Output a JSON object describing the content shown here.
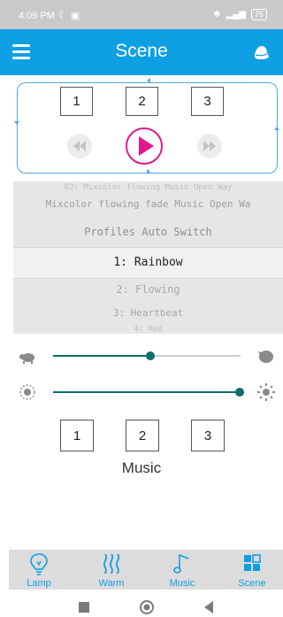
{
  "status": {
    "time": "4:09 PM",
    "battery": "75"
  },
  "appbar": {
    "title": "Scene"
  },
  "top_buttons": [
    "1",
    "2",
    "3"
  ],
  "picker": {
    "rows": [
      "02: Mixcolor flowing Music Open Way",
      "Mixcolor flowing fade Music Open Wa",
      "Profiles Auto Switch",
      "1: Rainbow",
      "2: Flowing",
      "3: Heartbeat",
      "4: Red"
    ],
    "selected": "1: Rainbow"
  },
  "sliders": {
    "speed": {
      "value": 0.52
    },
    "brightness": {
      "value": 1.0
    }
  },
  "music_buttons": [
    "1",
    "2",
    "3"
  ],
  "music_label": "Music",
  "nav": [
    {
      "label": "Lamp",
      "icon": "lamp-icon"
    },
    {
      "label": "Warm",
      "icon": "warm-icon"
    },
    {
      "label": "Music",
      "icon": "music-icon"
    },
    {
      "label": "Scene",
      "icon": "scene-icon"
    }
  ],
  "colors": {
    "accent": "#0f9fe3",
    "play": "#e0198a",
    "slider": "#0e6e6e"
  }
}
